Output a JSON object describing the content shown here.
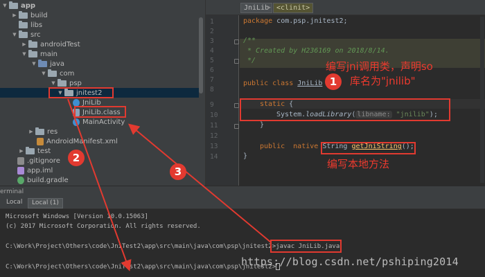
{
  "tree": {
    "items": [
      {
        "label": "app",
        "icon": "folder-icon",
        "arrow": "▼"
      },
      {
        "label": "build",
        "icon": "folder-icon",
        "arrow": "▶"
      },
      {
        "label": "libs",
        "icon": "folder-icon",
        "arrow": ""
      },
      {
        "label": "src",
        "icon": "folder-icon",
        "arrow": "▼"
      },
      {
        "label": "androidTest",
        "icon": "folder-icon",
        "arrow": "▶"
      },
      {
        "label": "main",
        "icon": "folder-icon",
        "arrow": "▼"
      },
      {
        "label": "java",
        "icon": "source-folder-icon",
        "arrow": "▼"
      },
      {
        "label": "com",
        "icon": "package-icon",
        "arrow": "▼"
      },
      {
        "label": "psp",
        "icon": "package-icon",
        "arrow": "▼"
      },
      {
        "label": "jnitest2",
        "icon": "package-icon",
        "arrow": "▼"
      },
      {
        "label": "JniLib",
        "icon": "class-icon",
        "arrow": ""
      },
      {
        "label": "JniLib.class",
        "icon": "class-file-icon",
        "arrow": ""
      },
      {
        "label": "MainActivity",
        "icon": "class-icon",
        "arrow": ""
      },
      {
        "label": "res",
        "icon": "folder-icon",
        "arrow": "▶"
      },
      {
        "label": "AndroidManifest.xml",
        "icon": "xml-file-icon",
        "arrow": ""
      },
      {
        "label": "test",
        "icon": "folder-icon",
        "arrow": "▶"
      },
      {
        "label": ".gitignore",
        "icon": "gitignore-file-icon",
        "arrow": ""
      },
      {
        "label": "app.iml",
        "icon": "iml-file-icon",
        "arrow": ""
      },
      {
        "label": "build.gradle",
        "icon": "gradle-file-icon",
        "arrow": ""
      }
    ]
  },
  "editor": {
    "breadcrumbs": [
      "JniLib",
      "<clinit>"
    ],
    "line_numbers": [
      "1",
      "2",
      "3",
      "4",
      "5",
      "6",
      "7",
      "8",
      "9",
      "10",
      "11",
      "12",
      "13",
      "14"
    ],
    "code": {
      "l1_kw": "package",
      "l1_rest": " com.psp.jnitest2;",
      "l3": "/**",
      "l4": " * Created by H236169 on 2018/8/14.",
      "l5": " */",
      "l7_kw": "public class",
      "l7_name": "JniLib",
      "l7_rest": " {",
      "l9_kw": "static",
      "l9_rest": " {",
      "l10_obj": "System.",
      "l10_method": "loadLibrary",
      "l10_open": "(",
      "l10_hint": "libname:",
      "l10_str": "\"jnilib\"",
      "l10_close": ");",
      "l11": "}",
      "l13_kw": "public  native",
      "l13_type": "String",
      "l13_fn": "getJniString",
      "l13_rest": "();",
      "l14": "}"
    }
  },
  "terminal": {
    "title": "erminal",
    "tabs": [
      "Local",
      "Local (1)"
    ],
    "lines": [
      "Microsoft Windows [Version 10.0.15063]",
      "(c) 2017 Microsoft Corporation. All rights reserved.",
      "C:\\Work\\Project\\Others\\code\\JniTest2\\app\\src\\main\\java\\com\\psp\\jnitest2>",
      "javac JniLib.java",
      "C:\\Work\\Project\\Others\\code\\JniTest2\\app\\src\\main\\java\\com\\psp\\jnitest2>"
    ]
  },
  "annotations": {
    "badges": [
      "1",
      "2",
      "3"
    ],
    "note1_line1": "编写jni调用类，声明so",
    "note1_line2": "库名为\"jnilib\"",
    "note2": "编写本地方法",
    "color": "#e23a30"
  },
  "watermark": "https://blog.csdn.net/pshiping2014"
}
